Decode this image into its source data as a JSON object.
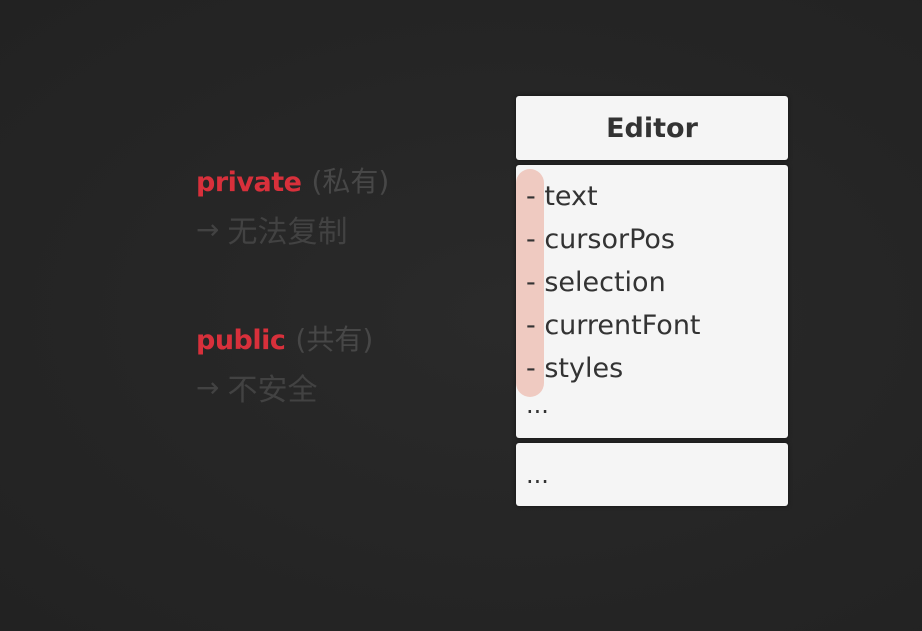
{
  "notes": [
    {
      "keyword": "private",
      "gloss": "(私有)",
      "arrow": "→",
      "consequence": "无法复制"
    },
    {
      "keyword": "public",
      "gloss": "(共有)",
      "arrow": "→",
      "consequence": "不安全"
    }
  ],
  "uml": {
    "class_name": "Editor",
    "fields": [
      "- text",
      "- cursorPos",
      "- selection",
      "- currentFont",
      "- styles"
    ],
    "fields_more": "...",
    "methods_more": "..."
  },
  "colors": {
    "background": "#262626",
    "keyword": "#d8303b",
    "muted_text": "#474747",
    "box": "#f5f5f5",
    "highlight": "#e89682"
  }
}
